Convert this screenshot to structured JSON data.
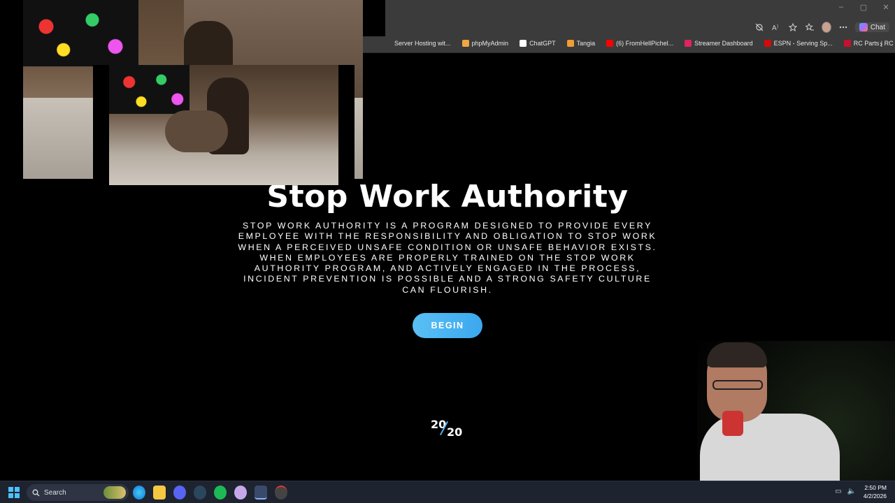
{
  "browser": {
    "window_controls": {
      "minimize": "–",
      "maximize": "▢",
      "close": "✕"
    },
    "toolbar": {
      "chat_label": "Chat"
    },
    "bookmarks": [
      {
        "label": "Server Hosting wit...",
        "color": "#3b3b3b"
      },
      {
        "label": "phpMyAdmin",
        "color": "#f2a541"
      },
      {
        "label": "ChatGPT",
        "color": "#ffffff"
      },
      {
        "label": "Tangia",
        "color": "#f39c32"
      },
      {
        "label": "(6) FromHellPichel...",
        "color": "#ff0000"
      },
      {
        "label": "Streamer Dashboard",
        "color": "#e0245e"
      },
      {
        "label": "ESPN - Serving Sp...",
        "color": "#d50a0a"
      },
      {
        "label": "RC Parts | RC Car P...",
        "color": "#c8102e"
      }
    ],
    "more_label": "›"
  },
  "page": {
    "title": "Stop Work Authority",
    "description": "STOP WORK AUTHORITY IS A PROGRAM DESIGNED TO PROVIDE EVERY EMPLOYEE WITH THE RESPONSIBILITY AND OBLIGATION TO STOP WORK WHEN A PERCEIVED UNSAFE CONDITION OR UNSAFE BEHAVIOR EXISTS. WHEN EMPLOYEES ARE PROPERLY TRAINED ON THE STOP WORK AUTHORITY PROGRAM, AND ACTIVELY ENGAGED IN THE PROCESS, INCIDENT PREVENTION IS POSSIBLE AND A STRONG SAFETY CULTURE CAN FLOURISH.",
    "begin_label": "BEGIN",
    "logo_top": "20",
    "logo_bottom": "20",
    "accent_color": "#4fb3f0"
  },
  "taskbar": {
    "search_label": "Search",
    "time": "2:50 PM",
    "date": "4/2/2026"
  }
}
